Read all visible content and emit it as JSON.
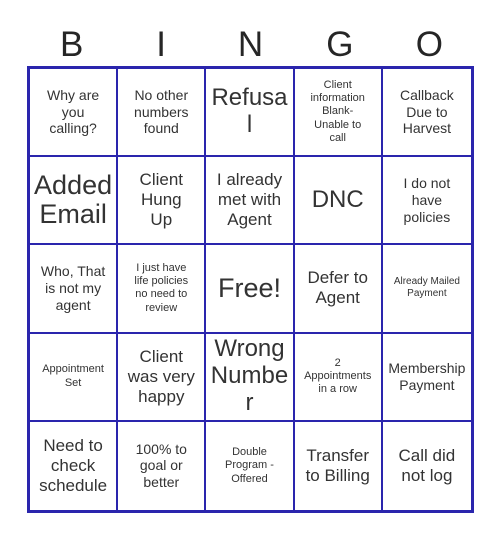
{
  "card": {
    "title": "BINGO",
    "header_letters": [
      "B",
      "I",
      "N",
      "G",
      "O"
    ],
    "colors": {
      "grid_border": "#2a25ad",
      "cell_text": "#333333",
      "header_text": "#262626",
      "background": "#ffffff"
    },
    "grid": {
      "columns": 5,
      "rows": 5,
      "free_space_index": 12
    },
    "cells": [
      {
        "text": "Why are you calling?",
        "size": "sm"
      },
      {
        "text": "No other numbers found",
        "size": "sm"
      },
      {
        "text": "Refusal",
        "size": "lg"
      },
      {
        "text": "Client information Blank- Unable to call",
        "size": "xs"
      },
      {
        "text": "Callback Due to Harvest",
        "size": "sm"
      },
      {
        "text": "Added Email",
        "size": "xl"
      },
      {
        "text": "Client Hung Up",
        "size": "md"
      },
      {
        "text": "I already met with Agent",
        "size": "md"
      },
      {
        "text": "DNC",
        "size": "lg"
      },
      {
        "text": "I do not have policies",
        "size": "sm"
      },
      {
        "text": "Who, That is not my agent",
        "size": "sm"
      },
      {
        "text": "I just have life policies no need to review",
        "size": "xs"
      },
      {
        "text": "Free!",
        "size": "xl"
      },
      {
        "text": "Defer to Agent",
        "size": "md"
      },
      {
        "text": "Already Mailed Payment",
        "size": "xxs"
      },
      {
        "text": "Appointment Set",
        "size": "xs"
      },
      {
        "text": "Client was very happy",
        "size": "md"
      },
      {
        "text": "Wrong Number",
        "size": "lg"
      },
      {
        "text": "2 Appointments in a row",
        "size": "xs"
      },
      {
        "text": "Membership Payment",
        "size": "sm"
      },
      {
        "text": "Need to check schedule",
        "size": "md"
      },
      {
        "text": "100% to goal or better",
        "size": "sm"
      },
      {
        "text": "Double Program - Offered",
        "size": "xs"
      },
      {
        "text": "Transfer to Billing",
        "size": "md"
      },
      {
        "text": "Call did not log",
        "size": "md"
      }
    ]
  }
}
